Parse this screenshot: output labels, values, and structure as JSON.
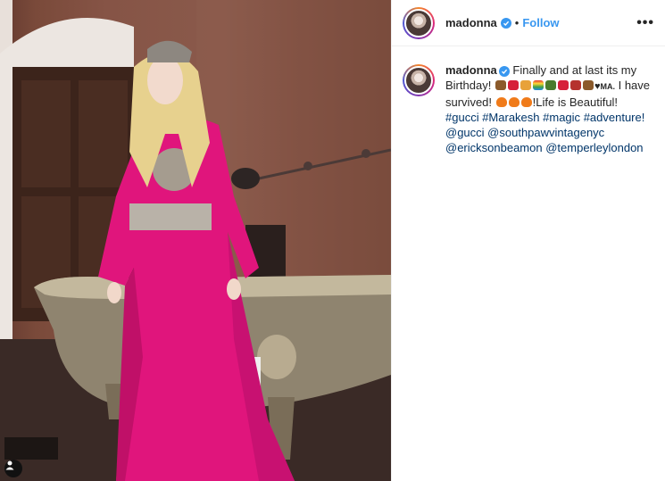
{
  "post": {
    "username": "madonna",
    "follow_label": "Follow",
    "separator": "•",
    "more_label": "•••"
  },
  "caption": {
    "username": "madonna",
    "text_1": "Finally and at last its my Birthday!",
    "emoji_row_1": [
      "cake",
      "heart",
      "party-popper",
      "rainbow",
      "bottle",
      "heart",
      "gift",
      "cake",
      "heart"
    ],
    "ma": "MA.",
    "text_2": "I have survived!",
    "emoji_row_2": [
      "fire",
      "fire",
      "fire"
    ],
    "text_3": "!Life is Beautiful!",
    "hashtags_1": [
      "#gucci",
      "#Marakesh",
      "#magic",
      "#adventure!"
    ],
    "mention_gucci": "@gucci",
    "mention_2": "@southpawvintagenyc",
    "mention_3": "@ericksonbeamon",
    "mention_4": "@temperleylondon"
  },
  "colors": {
    "link": "#3897f0",
    "hashtag": "#003569",
    "text": "#262626",
    "dress": "#e0157c"
  }
}
